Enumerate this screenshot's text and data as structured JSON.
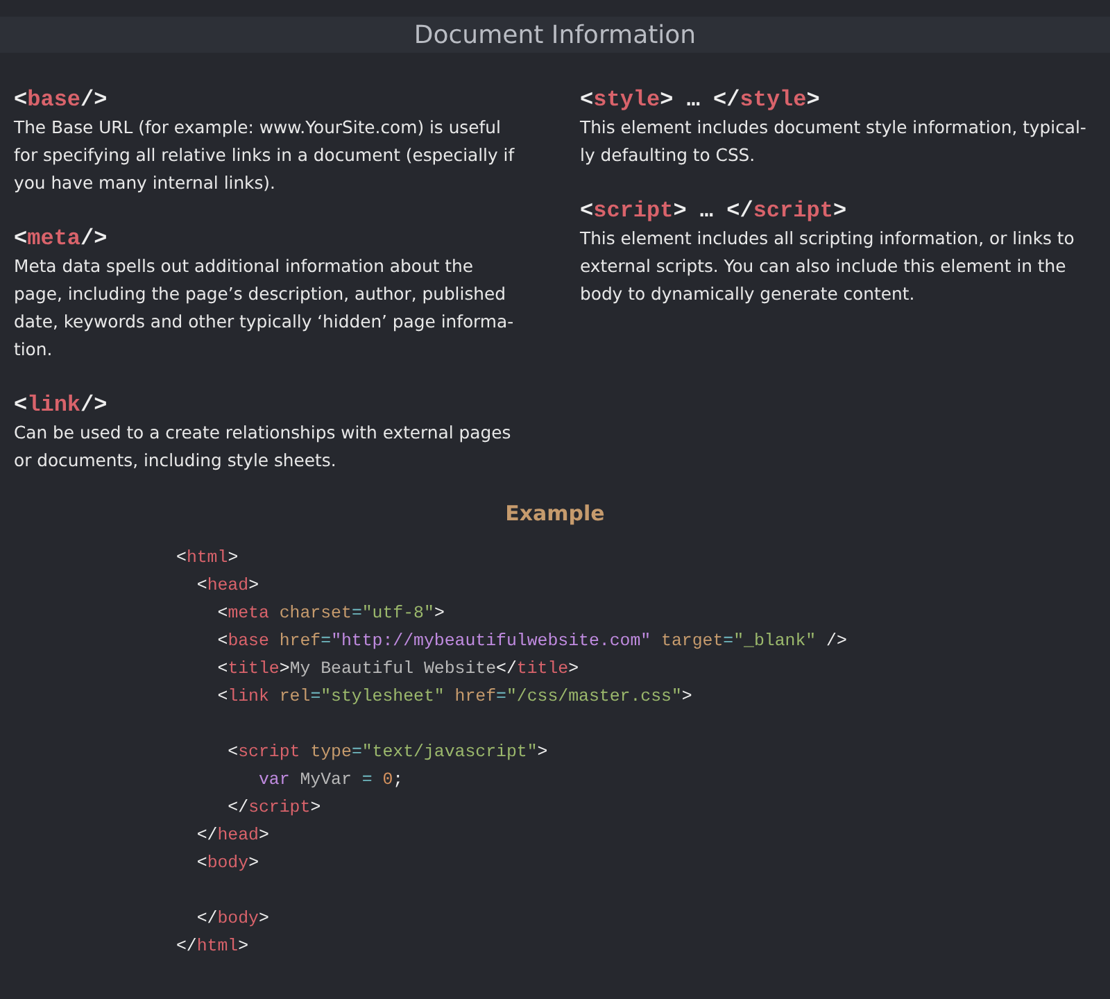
{
  "title": "Document Information",
  "columns": [
    {
      "entries": [
        {
          "heading": [
            {
              "kind": "punct",
              "text": "<"
            },
            {
              "kind": "tag",
              "text": "base"
            },
            {
              "kind": "punct",
              "text": "/>"
            }
          ],
          "text": "The Base URL (for example: www.YourSite.com) is useful for specifying all relative links in a document (especially if you have many internal links)."
        },
        {
          "heading": [
            {
              "kind": "punct",
              "text": "<"
            },
            {
              "kind": "tag",
              "text": "meta"
            },
            {
              "kind": "punct",
              "text": "/>"
            }
          ],
          "text": "Meta data spells out additional information about the page, including the page’s description, author, published date, keywords and other typically ‘hidden’ page informa-tion."
        },
        {
          "heading": [
            {
              "kind": "punct",
              "text": "<"
            },
            {
              "kind": "tag",
              "text": "link"
            },
            {
              "kind": "punct",
              "text": "/>"
            }
          ],
          "text": "Can be used to a create relationships with external pages or documents, including style sheets."
        }
      ]
    },
    {
      "entries": [
        {
          "heading": [
            {
              "kind": "punct",
              "text": "<"
            },
            {
              "kind": "tag",
              "text": "style"
            },
            {
              "kind": "punct",
              "text": "> … </"
            },
            {
              "kind": "tag",
              "text": "style"
            },
            {
              "kind": "punct",
              "text": ">"
            }
          ],
          "text": "This element includes document style information, typical-ly defaulting to CSS."
        },
        {
          "heading": [
            {
              "kind": "punct",
              "text": "<"
            },
            {
              "kind": "tag",
              "text": "script"
            },
            {
              "kind": "punct",
              "text": "> … </"
            },
            {
              "kind": "tag",
              "text": "script"
            },
            {
              "kind": "punct",
              "text": ">"
            }
          ],
          "text": "This element includes all scripting information, or links to external scripts. You can also include this element in the body to dynamically generate content."
        }
      ]
    }
  ],
  "example": {
    "title": "Example",
    "lines": [
      {
        "kind": "code",
        "tokens": [
          {
            "kind": "punct",
            "text": "<"
          },
          {
            "kind": "tag",
            "text": "html"
          },
          {
            "kind": "punct",
            "text": ">"
          }
        ]
      },
      {
        "kind": "code",
        "tokens": [
          {
            "kind": "punct",
            "text": "  <"
          },
          {
            "kind": "tag",
            "text": "head"
          },
          {
            "kind": "punct",
            "text": ">"
          }
        ]
      },
      {
        "kind": "code",
        "tokens": [
          {
            "kind": "punct",
            "text": "    <"
          },
          {
            "kind": "tag",
            "text": "meta "
          },
          {
            "kind": "attr",
            "text": "charset"
          },
          {
            "kind": "op",
            "text": "="
          },
          {
            "kind": "string",
            "text": "\"utf-8\""
          },
          {
            "kind": "punct",
            "text": ">"
          }
        ]
      },
      {
        "kind": "code",
        "tokens": [
          {
            "kind": "punct",
            "text": "    <"
          },
          {
            "kind": "tag",
            "text": "base "
          },
          {
            "kind": "attr",
            "text": "href"
          },
          {
            "kind": "op",
            "text": "="
          },
          {
            "kind": "url",
            "text": "\"http://mybeautifulwebsite.com\" "
          },
          {
            "kind": "attr",
            "text": "target"
          },
          {
            "kind": "op",
            "text": "="
          },
          {
            "kind": "string",
            "text": "\"_blank\""
          },
          {
            "kind": "punct",
            "text": " />"
          }
        ]
      },
      {
        "kind": "code",
        "tokens": [
          {
            "kind": "punct",
            "text": "    <"
          },
          {
            "kind": "tag",
            "text": "title"
          },
          {
            "kind": "punct",
            "text": ">"
          },
          {
            "kind": "text",
            "text": "My Beautiful Website"
          },
          {
            "kind": "punct",
            "text": "</"
          },
          {
            "kind": "tag",
            "text": "title"
          },
          {
            "kind": "punct",
            "text": ">"
          }
        ]
      },
      {
        "kind": "code",
        "tokens": [
          {
            "kind": "punct",
            "text": "    <"
          },
          {
            "kind": "tag",
            "text": "link "
          },
          {
            "kind": "attr",
            "text": "rel"
          },
          {
            "kind": "op",
            "text": "="
          },
          {
            "kind": "string",
            "text": "\"stylesheet\" "
          },
          {
            "kind": "attr",
            "text": "href"
          },
          {
            "kind": "op",
            "text": "="
          },
          {
            "kind": "string",
            "text": "\"/css/master.css\""
          },
          {
            "kind": "punct",
            "text": ">"
          }
        ]
      },
      {
        "kind": "blank"
      },
      {
        "kind": "code",
        "tokens": [
          {
            "kind": "punct",
            "text": "     <"
          },
          {
            "kind": "tag",
            "text": "script "
          },
          {
            "kind": "attr",
            "text": "type"
          },
          {
            "kind": "op",
            "text": "="
          },
          {
            "kind": "string",
            "text": "\"text/javascript\""
          },
          {
            "kind": "punct",
            "text": ">"
          }
        ]
      },
      {
        "kind": "code",
        "tokens": [
          {
            "kind": "keyword",
            "text": "        var "
          },
          {
            "kind": "text",
            "text": "MyVar "
          },
          {
            "kind": "op",
            "text": "= "
          },
          {
            "kind": "number",
            "text": "0"
          },
          {
            "kind": "punct",
            "text": ";"
          }
        ]
      },
      {
        "kind": "code",
        "tokens": [
          {
            "kind": "punct",
            "text": "     </"
          },
          {
            "kind": "tag",
            "text": "script"
          },
          {
            "kind": "punct",
            "text": ">"
          }
        ]
      },
      {
        "kind": "code",
        "tokens": [
          {
            "kind": "punct",
            "text": "  </"
          },
          {
            "kind": "tag",
            "text": "head"
          },
          {
            "kind": "punct",
            "text": ">"
          }
        ]
      },
      {
        "kind": "code",
        "tokens": [
          {
            "kind": "punct",
            "text": "  <"
          },
          {
            "kind": "tag",
            "text": "body"
          },
          {
            "kind": "punct",
            "text": ">"
          }
        ]
      },
      {
        "kind": "blank"
      },
      {
        "kind": "code",
        "tokens": [
          {
            "kind": "punct",
            "text": "  </"
          },
          {
            "kind": "tag",
            "text": "body"
          },
          {
            "kind": "punct",
            "text": ">"
          }
        ]
      },
      {
        "kind": "code",
        "tokens": [
          {
            "kind": "punct",
            "text": "</"
          },
          {
            "kind": "tag",
            "text": "html"
          },
          {
            "kind": "punct",
            "text": ">"
          }
        ]
      }
    ]
  }
}
